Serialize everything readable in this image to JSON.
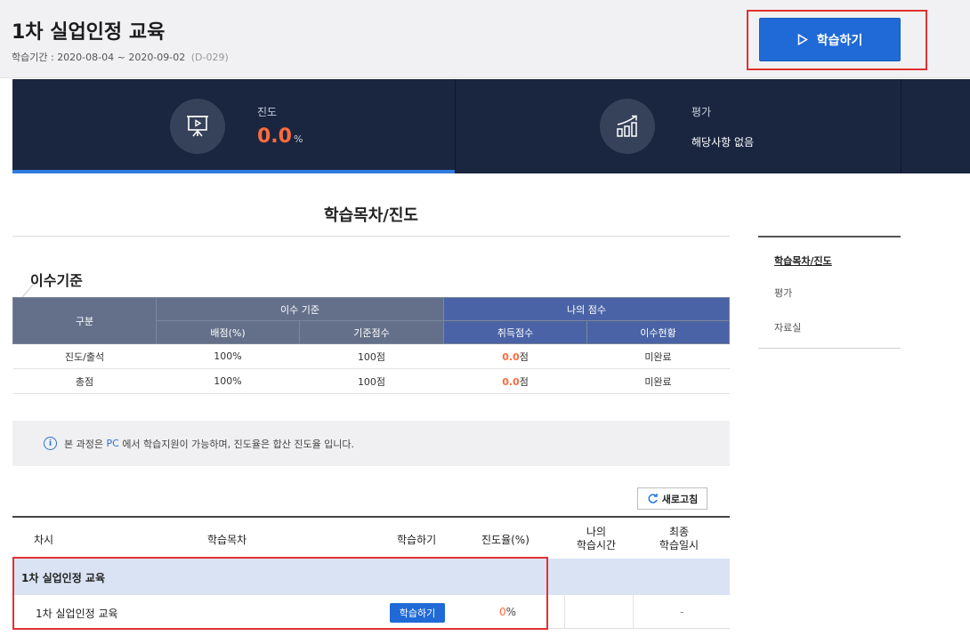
{
  "header": {
    "course_title": "1차 실업인정 교육",
    "period_label": "학습기간 :",
    "period_value": "2020-08-04 ~ 2020-09-02",
    "dday": "(D-029)",
    "start_button_label": "학습하기"
  },
  "stats": {
    "progress": {
      "label": "진도",
      "value": "0.0",
      "unit": "%",
      "icon": "presentation-board-icon"
    },
    "evaluation": {
      "label": "평가",
      "text": "해당사항 없음",
      "icon": "growth-chart-icon"
    }
  },
  "section_title": "학습목차/진도",
  "side_nav": {
    "items": [
      {
        "label": "학습목차/진도",
        "active": true
      },
      {
        "label": "평가",
        "active": false
      },
      {
        "label": "자료실",
        "active": false
      }
    ]
  },
  "criteria": {
    "title": "이수기준",
    "headers": {
      "category": "구분",
      "criteria_group": "이수 기준",
      "my_score_group": "나의 점수",
      "weight": "배점(%)",
      "base_score": "기준점수",
      "earned_score": "취득점수",
      "status": "이수현황"
    },
    "rows": [
      {
        "category": "진도/출석",
        "weight": "100%",
        "base_score": "100점",
        "earned_value": "0.0",
        "earned_unit": "점",
        "status": "미완료"
      },
      {
        "category": "총점",
        "weight": "100%",
        "base_score": "100점",
        "earned_value": "0.0",
        "earned_unit": "점",
        "status": "미완료"
      }
    ]
  },
  "info": {
    "icon": "info-icon",
    "text_prefix": "본 과정은",
    "highlight": "PC",
    "text_suffix": "에서 학습지원이 가능하며, 진도율은 합산 진도율 입니다."
  },
  "refresh_label": "새로고침",
  "progress_table": {
    "headers": {
      "round": "차시",
      "contents": "학습목차",
      "study": "학습하기",
      "rate": "진도율(%)",
      "my_time_1": "나의",
      "my_time_2": "학습시간",
      "last_date_1": "최종",
      "last_date_2": "학습일시"
    },
    "group_label": "1차 실업인정 교육",
    "rows": [
      {
        "name": "1차 실업인정 교육",
        "button": "학습하기",
        "rate_value": "0",
        "rate_unit": "%",
        "my_time": "",
        "last_date": "-"
      }
    ]
  },
  "colors": {
    "navy": "#1a2640",
    "primary_blue": "#1f6ad7",
    "accent_orange": "#ff6b3d",
    "highlight_red": "#e03131"
  }
}
